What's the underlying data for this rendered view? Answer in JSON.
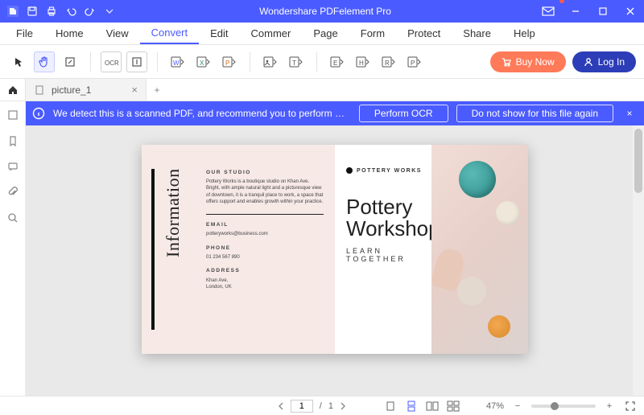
{
  "titlebar": {
    "title": "Wondershare PDFelement Pro"
  },
  "menu": {
    "items": [
      "File",
      "Home",
      "View",
      "Convert",
      "Edit",
      "Commer",
      "Page",
      "Form",
      "Protect",
      "Share",
      "Help"
    ],
    "active_index": 3
  },
  "ribbon": {
    "buy_label": "Buy Now",
    "login_label": "Log In"
  },
  "tab": {
    "name": "picture_1",
    "close": "×",
    "add": "+"
  },
  "banner": {
    "message": "We detect this is a scanned PDF, and recommend you to perform OCR,...",
    "perform_label": "Perform OCR",
    "dismiss_label": "Do not show for this file again",
    "close": "×"
  },
  "document": {
    "left": {
      "vertical_label": "Information",
      "studio_heading": "OUR STUDIO",
      "studio_body": "Pottery Works is a boutique studio on Khan Ave. Bright, with ample natural light and a picturesque view of downtown, it is a tranquil place to work, a space that offers support and enables growth within your practice.",
      "email_heading": "EMAIL",
      "email_value": "potteryworks@business.com",
      "phone_heading": "PHONE",
      "phone_value": "01 234 567 890",
      "address_heading": "ADDRESS",
      "address_line1": "Khan Ave,",
      "address_line2": "London, UK"
    },
    "right": {
      "brand": "POTTERY WORKS",
      "headline1": "Pottery",
      "headline2": "Workshops",
      "subhead": "LEARN TOGETHER"
    }
  },
  "status": {
    "page_current": "1",
    "page_sep": "/",
    "page_total": "1",
    "zoom_label": "47%",
    "minus": "−",
    "plus": "+"
  }
}
